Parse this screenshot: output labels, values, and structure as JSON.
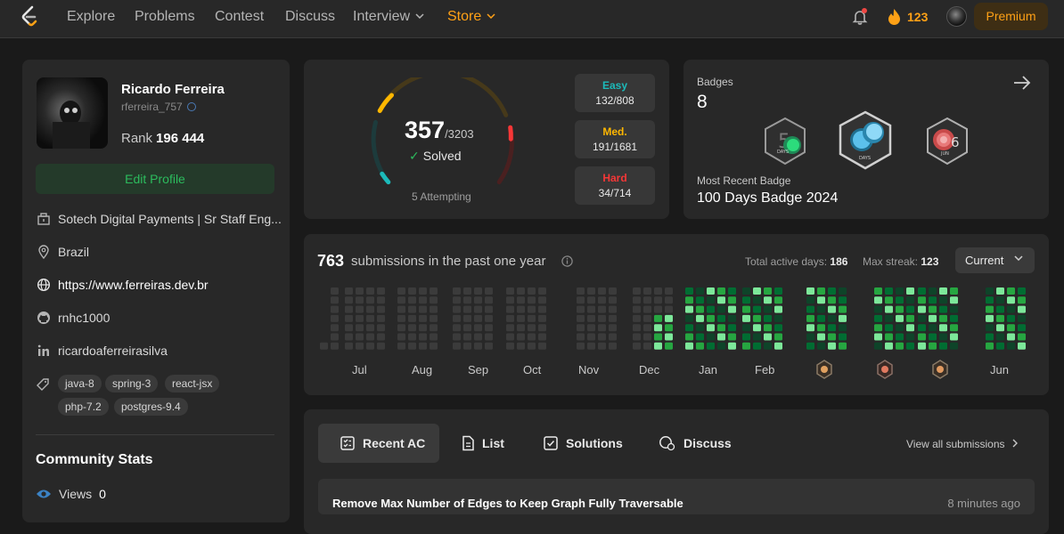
{
  "nav": {
    "items": [
      {
        "label": "Explore"
      },
      {
        "label": "Problems"
      },
      {
        "label": "Contest"
      },
      {
        "label": "Discuss"
      },
      {
        "label": "Interview"
      },
      {
        "label": "Store"
      }
    ],
    "streak_count": "123",
    "premium_label": "Premium"
  },
  "profile": {
    "name": "Ricardo Ferreira",
    "username": "rferreira_757",
    "rank_label": "Rank",
    "rank_value": "196 444",
    "edit_label": "Edit Profile",
    "company": "Sotech Digital Payments | Sr Staff Eng...",
    "location": "Brazil",
    "website": "https://www.ferreiras.dev.br",
    "github": "rnhc1000",
    "linkedin": "ricardoaferreirasilva",
    "tags": [
      "java-8",
      "spring-3",
      "react-jsx",
      "php-7.2",
      "postgres-9.4"
    ]
  },
  "community": {
    "title": "Community Stats",
    "views_label": "Views",
    "views_value": "0"
  },
  "solved": {
    "count": "357",
    "total": "/3203",
    "label": "Solved",
    "attempting": "5 Attempting",
    "easy": {
      "label": "Easy",
      "value": "132/808",
      "color": "#1cbaba"
    },
    "medium": {
      "label": "Med.",
      "value": "191/1681",
      "color": "#ffb700"
    },
    "hard": {
      "label": "Hard",
      "value": "34/714",
      "color": "#f63737"
    }
  },
  "badges": {
    "label": "Badges",
    "count": "8",
    "recent_label": "Most Recent Badge",
    "recent_name": "100 Days Badge 2024",
    "icons": [
      "50-days-badge-icon",
      "100-days-badge-icon",
      "june-badge-icon"
    ]
  },
  "activity": {
    "count": "763",
    "text": "submissions in the past one year",
    "active_days_label": "Total active days:",
    "active_days": "186",
    "max_streak_label": "Max streak:",
    "max_streak": "123",
    "range_select": "Current",
    "months": [
      "Jul",
      "Aug",
      "Sep",
      "Oct",
      "Nov",
      "Dec",
      "Jan",
      "Feb",
      "Jun"
    ]
  },
  "submissions": {
    "tabs": [
      {
        "label": "Recent AC"
      },
      {
        "label": "List"
      },
      {
        "label": "Solutions"
      },
      {
        "label": "Discuss"
      }
    ],
    "view_all": "View all submissions",
    "rows": [
      {
        "title": "Remove Max Number of Edges to Keep Graph Fully Traversable",
        "time": "8 minutes ago"
      }
    ]
  }
}
